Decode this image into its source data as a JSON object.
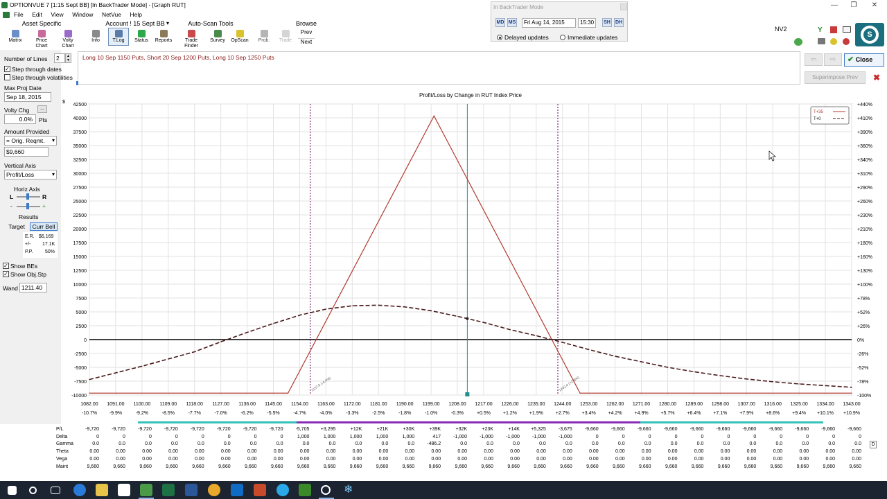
{
  "window": {
    "title": "OPTIONVUE 7   [1:15 Sept BB]   [In BackTrader Mode] - [Graph RUT]"
  },
  "menu": [
    "File",
    "Edit",
    "View",
    "Window",
    "NetVue",
    "Help"
  ],
  "toolbar": {
    "groups": {
      "asset": "Asset Specific",
      "account": "Account ! 15 Sept BB",
      "autoscan": "Auto-Scan Tools",
      "browse": "Browse"
    },
    "buttons": {
      "matrix": "Matrix",
      "price_chart": "Price Chart",
      "volty_chart": "Volty Chart",
      "info": "Info",
      "tlog": "T.Log",
      "status": "Status",
      "reports": "Reports",
      "trade_finder": "Trade Finder",
      "survey": "Survey",
      "opscan": "OpScan",
      "prob": "Prob.",
      "trade": "Trade",
      "prev": "Prev",
      "next": "Next"
    },
    "nv2": "NV2"
  },
  "backtrader": {
    "title": "In BackTrader Mode",
    "md": "MD",
    "ms": "MS",
    "date": "Fri Aug 14, 2015",
    "time": "15:30",
    "sh": "SH",
    "dh": "DH",
    "delayed": "Delayed updates",
    "immediate": "Immediate updates",
    "selected": "Delayed updates"
  },
  "left": {
    "lines_label": "Number of Lines",
    "lines_value": "2",
    "step_dates": "Step through dates",
    "step_dates_checked": true,
    "step_vols": "Step through volatilities",
    "step_vols_checked": false,
    "max_proj_label": "Max Proj Date",
    "max_proj_value": "Sep 18, 2015",
    "volty_label": "Volty Chg",
    "volty_value": "0.0%",
    "volty_unit": "Pts",
    "amount_label": "Amount Provided",
    "amount_select": "= Orig. Reqmt.",
    "amount_value": "$9,660",
    "vaxis_label": "Vertical Axis",
    "vaxis_value": "Profit/Loss",
    "haxis_label": "Horiz Axis",
    "haxis_l": "L",
    "haxis_r": "R",
    "haxis_minus": "-",
    "haxis_plus": "+",
    "results_label": "Results",
    "target": "Target",
    "curr_bell": "Curr Bell",
    "er_label": "E.R.",
    "er_value": "$6,169",
    "pm_label": "+/-",
    "pm_value": "17.1K",
    "pp_label": "P.P.",
    "pp_value": "50%",
    "show_bes": "Show BEs",
    "show_bes_checked": true,
    "show_obj": "Show Obj.Stp",
    "show_obj_checked": true,
    "wand_label": "Wand",
    "wand_value": "1211.40"
  },
  "position_desc": "Long 10 Sep 1150 Puts, Short 20 Sep 1200 Puts, Long 10 Sep 1250 Puts",
  "buttons": {
    "close": "Close",
    "superimpose": "Superimpose Prev"
  },
  "colors": {
    "t35": "#b03a2e",
    "t0": "#4a1a1a",
    "wand": "#1f8f8f",
    "be": "#7a2a6a",
    "purple_bar": "#8a2bb8",
    "teal_bar": "#33c2b8"
  },
  "chart_data": {
    "type": "line",
    "title": "Profit/Loss by Change in RUT Index Price",
    "yunit": "$",
    "ylim": [
      -10000,
      42500
    ],
    "y_ticks": [
      -10000,
      -7500,
      -5000,
      -2500,
      0,
      2500,
      5000,
      7500,
      10000,
      12500,
      15000,
      17500,
      20000,
      22500,
      25000,
      27500,
      30000,
      32500,
      35000,
      37500,
      40000,
      42500
    ],
    "y_right_ticks": [
      "-100%",
      "-78%",
      "-52%",
      "-26%",
      "0%",
      "+26%",
      "+52%",
      "+78%",
      "+100%",
      "+130%",
      "+160%",
      "+180%",
      "+210%",
      "+230%",
      "+260%",
      "+290%",
      "+310%",
      "+340%",
      "+360%",
      "+390%",
      "+410%",
      "+440%"
    ],
    "xlim": [
      1082,
      1343
    ],
    "x_ticks": [
      "1082.00",
      "1091.00",
      "1100.00",
      "1109.00",
      "1118.00",
      "1127.00",
      "1136.00",
      "1145.00",
      "1154.00",
      "1163.00",
      "1172.00",
      "1181.00",
      "1190.00",
      "1199.00",
      "1208.00",
      "1217.00",
      "1226.00",
      "1235.00",
      "1244.00",
      "1253.00",
      "1262.00",
      "1271.00",
      "1280.00",
      "1289.00",
      "1298.00",
      "1307.00",
      "1316.00",
      "1325.00",
      "1334.00",
      "1343.00"
    ],
    "x_pct_ticks": [
      "-10.7%",
      "-9.9%",
      "-9.2%",
      "-8.5%",
      "-7.7%",
      "-7.0%",
      "-6.2%",
      "-5.5%",
      "-4.7%",
      "-4.0%",
      "-3.3%",
      "-2.5%",
      "-1.8%",
      "-1.0%",
      "-0.3%",
      "+0.5%",
      "+1.2%",
      "+1.9%",
      "+2.7%",
      "+3.4%",
      "+4.2%",
      "+4.9%",
      "+5.7%",
      "+6.4%",
      "+7.1%",
      "+7.9%",
      "+8.6%",
      "+9.4%",
      "+10.1%",
      "+10.9%"
    ],
    "legend": [
      "T+35",
      "T+0"
    ],
    "legend_position": "top-right",
    "grid": true,
    "series": [
      {
        "name": "T+35",
        "style": "solid",
        "x": [
          1082,
          1150,
          1200,
          1250,
          1343
        ],
        "y": [
          -9660,
          -9660,
          40340,
          -9660,
          -9660
        ]
      },
      {
        "name": "T+0",
        "style": "dashed",
        "x": [
          1082,
          1100,
          1118,
          1127,
          1136,
          1145,
          1154,
          1163,
          1172,
          1181,
          1190,
          1199,
          1208,
          1217,
          1226,
          1235,
          1244,
          1253,
          1262,
          1271,
          1280,
          1289,
          1298,
          1307,
          1316,
          1325,
          1334,
          1343
        ],
        "y": [
          -7200,
          -4800,
          -2200,
          -400,
          1300,
          2900,
          4400,
          5500,
          6100,
          6200,
          5900,
          5200,
          4200,
          3100,
          1800,
          700,
          -500,
          -1800,
          -3000,
          -4000,
          -5000,
          -5800,
          -6500,
          -7100,
          -7600,
          -8000,
          -8300,
          -8600
        ]
      }
    ],
    "breakevens": [
      {
        "x": 1157.6,
        "label": "1157.6 (-4.4%)"
      },
      {
        "x": 1242.4,
        "label": "1242.4 (+2.6%)"
      }
    ],
    "wand_x": 1211.4
  },
  "table": {
    "row_labels": [
      "P/L",
      "Delta",
      "Gamma",
      "Theta",
      "Vega",
      "Maint"
    ],
    "rows": [
      [
        "-9,720",
        "-9,720",
        "-9,720",
        "-9,720",
        "-9,720",
        "-9,720",
        "-9,720",
        "-9,720",
        "-5,705",
        "+3,295",
        "+12K",
        "+21K",
        "+30K",
        "+39K",
        "+32K",
        "+23K",
        "+14K",
        "+5,325",
        "-3,675",
        "-9,660",
        "-9,660",
        "-9,660",
        "-9,660",
        "-9,660",
        "-9,660",
        "-9,660",
        "-9,660",
        "-9,660",
        "-9,660",
        "-9,660"
      ],
      [
        "0",
        "0",
        "0",
        "0",
        "0",
        "0",
        "0",
        "0",
        "1,000",
        "1,000",
        "1,000",
        "1,000",
        "1,000",
        "417",
        "-1,000",
        "-1,000",
        "-1,000",
        "-1,000",
        "-1,000",
        "0",
        "0",
        "0",
        "0",
        "0",
        "0",
        "0",
        "0",
        "0",
        "0",
        "0"
      ],
      [
        "0.0",
        "0.0",
        "0.0",
        "0.0",
        "0.0",
        "0.0",
        "0.0",
        "0.0",
        "0.0",
        "0.0",
        "0.0",
        "0.0",
        "0.0",
        "-486.2",
        "0.0",
        "0.0",
        "0.0",
        "0.0",
        "0.0",
        "0.0",
        "0.0",
        "0.0",
        "0.0",
        "0.0",
        "0.0",
        "0.0",
        "0.0",
        "0.0",
        "0.0",
        "0.0"
      ],
      [
        "0.00",
        "0.00",
        "0.00",
        "0.00",
        "0.00",
        "0.00",
        "0.00",
        "0.00",
        "0.00",
        "0.00",
        "0.00",
        "0.00",
        "0.00",
        "0.00",
        "0.00",
        "0.00",
        "0.00",
        "0.00",
        "0.00",
        "0.00",
        "0.00",
        "0.00",
        "0.00",
        "0.00",
        "0.00",
        "0.00",
        "0.00",
        "0.00",
        "0.00",
        "0.00"
      ],
      [
        "0.00",
        "0.00",
        "0.00",
        "0.00",
        "0.00",
        "0.00",
        "0.00",
        "0.00",
        "0.00",
        "0.00",
        "0.00",
        "0.00",
        "0.00",
        "0.00",
        "0.00",
        "0.00",
        "0.00",
        "0.00",
        "0.00",
        "0.00",
        "0.00",
        "0.00",
        "0.00",
        "0.00",
        "0.00",
        "0.00",
        "0.00",
        "0.00",
        "0.00",
        "0.00"
      ],
      [
        "9,660",
        "9,660",
        "9,660",
        "9,660",
        "9,660",
        "9,660",
        "9,660",
        "9,660",
        "9,660",
        "9,660",
        "9,660",
        "9,660",
        "9,660",
        "9,660",
        "9,660",
        "9,660",
        "9,660",
        "9,660",
        "9,660",
        "9,660",
        "9,660",
        "9,660",
        "9,660",
        "9,660",
        "9,660",
        "9,660",
        "9,660",
        "9,660",
        "9,660",
        "9,660"
      ]
    ],
    "d_button": "D"
  }
}
